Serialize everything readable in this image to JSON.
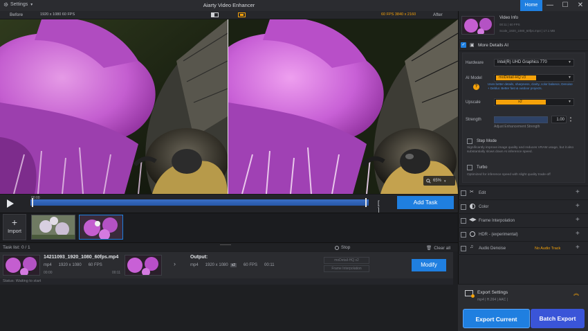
{
  "titlebar": {
    "settings": "Settings",
    "app_title": "Aiarty Video Enhancer",
    "home": "Home",
    "minimize": "—",
    "maximize": "☐",
    "close": "✕"
  },
  "compare": {
    "before": "Before",
    "before_meta": "1920 x 1080 60 FPS",
    "after": "After",
    "after_meta": "60 FPS 3840 x 2160"
  },
  "preview": {
    "zoom": "65%"
  },
  "timeline": {
    "time": "00:00",
    "add_task": "Add Task"
  },
  "thumbs": {
    "import": "Import"
  },
  "tasklist": {
    "label": "Task list:",
    "count": "0 / 1",
    "stop": "Stop",
    "clear_all": "Clear all",
    "file_name": "14211093_1920_1080_60fps.mp4",
    "src_format": "mp4",
    "src_res": "1920 x 1080",
    "src_fps": "60 FPS",
    "src_start": "00:00",
    "src_end": "00:11",
    "output_label": "Output:",
    "out_format": "mp4",
    "out_res": "1920 x 1080",
    "out_scale": "x2",
    "out_fps": "60 FPS",
    "out_dur": "00:11",
    "out_model": "moDetail-HQ x2",
    "out_interp": "Frame Interpolation",
    "modify": "Modify",
    "status": "Status: Waiting to start"
  },
  "rightpanel": {
    "video_info_title": "Video Info",
    "video_info_line1": "1920 x 1080 | 00:11 | 60 FPS | H.264",
    "video_info_line2": "00:11 | 60 FPS",
    "video_info_line3": "Scale_1920_1080_60fps.mp4 | 17.1 MB",
    "more_details": "More Details AI",
    "hardware_label": "Hardware",
    "hardware_value": "Intel(R) UHD Graphics 770",
    "ai_model_label": "AI Model",
    "ai_model_value": "moDetail-HQ  v3",
    "ai_model_desc": "Uses better details, sharpness, clarity, color balance, Denoise + Deblur. Better fast & outdoor projects.",
    "upscale_label": "Upscale",
    "upscale_value": "x2",
    "strength_label": "Strength",
    "strength_value": "1.00",
    "strength_caption": "Adjust Enhancement Strength",
    "step_mode": "Step Mode",
    "step_desc": "Significantly improve image quality and reduces VRAM usage, but it also substantially slows down AI inference speed.",
    "turbo": "Turbo",
    "turbo_desc": "Optimized for inference speed with slight quality trade-off",
    "features": [
      {
        "label": "Edit",
        "extra": ""
      },
      {
        "label": "Color",
        "extra": ""
      },
      {
        "label": "Frame Interpolation",
        "extra": ""
      },
      {
        "label": "HDR - (experimental)",
        "extra": ""
      },
      {
        "label": "Audio Denoise",
        "extra": "No Audio Track"
      }
    ],
    "export_settings": "Export Settings",
    "export_meta": "mp4 | H.264 | AAC |",
    "export_current": "Export Current",
    "batch_export": "Batch Export"
  },
  "colors": {
    "accent": "#1f7fe0",
    "accent_orange": "#f5a20a",
    "flower": "#c45ed0"
  }
}
